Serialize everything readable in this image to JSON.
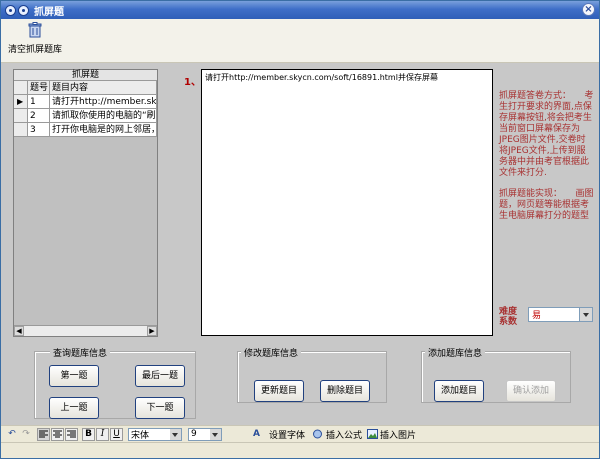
{
  "window": {
    "title": "抓屏题"
  },
  "toolbar": {
    "clear_label": "清空抓屏题库"
  },
  "grid": {
    "caption": "抓屏题",
    "headers": {
      "num": "题号",
      "content": "题目内容"
    },
    "rows": [
      {
        "num": "1",
        "content": "请打开http://member.skycn.c"
      },
      {
        "num": "2",
        "content": "请抓取你使用的电脑的“刷新"
      },
      {
        "num": "3",
        "content": "打开你电脑是的网上邻居，并"
      }
    ]
  },
  "question": {
    "number": "1、",
    "text": "请打开http://member.skycn.com/soft/16891.html并保存屏幕"
  },
  "info": {
    "method_text": "抓屏题答卷方式：　　考生打开要求的界面,点保存屏幕按钮,将会把考生当前窗口屏幕保存为JPEG图片文件,交卷时将JPEG文件,上传到服务器中并由考官根据此文件来打分.",
    "feature_text": "抓屏题能实现：　　画图题，网页题等能根据考生电脑屏幕打分的题型"
  },
  "difficulty": {
    "label": "难度系数",
    "value": "易"
  },
  "query_group": {
    "title": "查询题库信息",
    "first": "第一题",
    "last": "最后一题",
    "prev": "上一题",
    "next": "下一题"
  },
  "modify_group": {
    "title": "修改题库信息",
    "update": "更新题目",
    "delete": "删除题目"
  },
  "add_group": {
    "title": "添加题库信息",
    "add": "添加题目",
    "confirm": "确认添加"
  },
  "format": {
    "bold": "B",
    "italic": "I",
    "underline": "U",
    "font_name": "宋体",
    "font_size": "9",
    "set_font": "设置字体",
    "insert_formula": "插入公式",
    "insert_image": "插入图片"
  }
}
